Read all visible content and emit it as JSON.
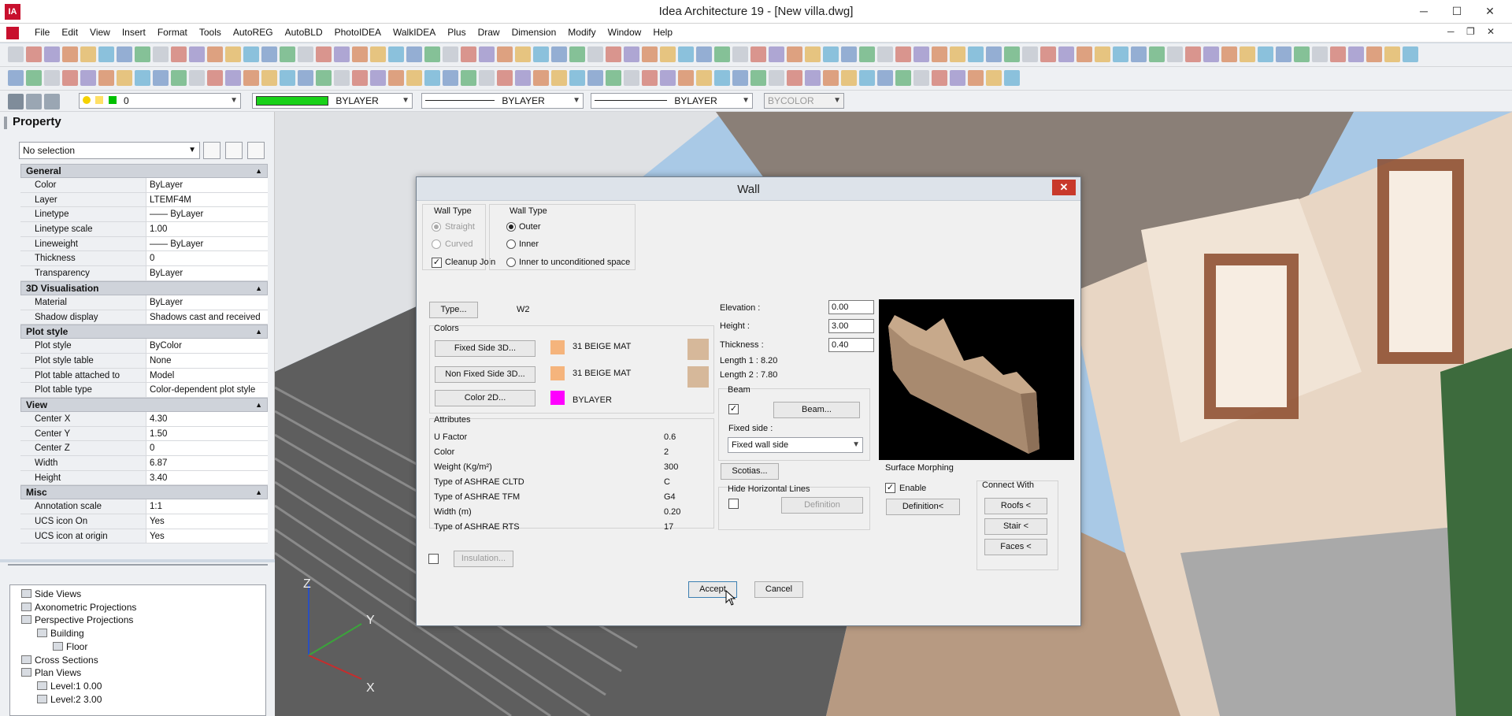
{
  "window": {
    "title": "Idea Architecture 19 - [New villa.dwg]",
    "app_icon": "IA",
    "minimize": "─",
    "maximize": "☐",
    "close": "✕",
    "doc_minimize": "─",
    "doc_restore": "❐",
    "doc_close": "✕"
  },
  "menu": [
    "File",
    "Edit",
    "View",
    "Insert",
    "Format",
    "Tools",
    "AutoREG",
    "AutoBLD",
    "PhotoIDEA",
    "WalkIDEA",
    "Plus",
    "Draw",
    "Dimension",
    "Modify",
    "Window",
    "Help"
  ],
  "layer_bar": {
    "layer": "0",
    "color": "BYLAYER",
    "linetype": "BYLAYER",
    "lineweight": "BYLAYER",
    "plotstyle": "BYCOLOR"
  },
  "property_panel": {
    "title": "Property",
    "selection": "No selection",
    "categories": [
      {
        "name": "General",
        "rows": [
          {
            "k": "Color",
            "v": "ByLayer"
          },
          {
            "k": "Layer",
            "v": "LTEMF4M"
          },
          {
            "k": "Linetype",
            "v": "—— ByLayer"
          },
          {
            "k": "Linetype scale",
            "v": "1.00"
          },
          {
            "k": "Lineweight",
            "v": "—— ByLayer"
          },
          {
            "k": "Thickness",
            "v": "0"
          },
          {
            "k": "Transparency",
            "v": "ByLayer"
          }
        ]
      },
      {
        "name": "3D Visualisation",
        "rows": [
          {
            "k": "Material",
            "v": "ByLayer"
          },
          {
            "k": "Shadow display",
            "v": "Shadows cast and received"
          }
        ]
      },
      {
        "name": "Plot style",
        "rows": [
          {
            "k": "Plot style",
            "v": "ByColor"
          },
          {
            "k": "Plot style table",
            "v": "None"
          },
          {
            "k": "Plot table attached to",
            "v": "Model"
          },
          {
            "k": "Plot table type",
            "v": "Color-dependent plot style"
          }
        ]
      },
      {
        "name": "View",
        "rows": [
          {
            "k": "Center X",
            "v": "4.30"
          },
          {
            "k": "Center Y",
            "v": "1.50"
          },
          {
            "k": "Center Z",
            "v": "0"
          },
          {
            "k": "Width",
            "v": "6.87"
          },
          {
            "k": "Height",
            "v": "3.40"
          }
        ]
      },
      {
        "name": "Misc",
        "rows": [
          {
            "k": "Annotation scale",
            "v": "1:1"
          },
          {
            "k": "UCS icon On",
            "v": "Yes"
          },
          {
            "k": "UCS icon at origin",
            "v": "Yes"
          }
        ]
      }
    ]
  },
  "tree": [
    {
      "label": "Side Views",
      "level": 0
    },
    {
      "label": "Axonometric Projections",
      "level": 0
    },
    {
      "label": "Perspective Projections",
      "level": 0
    },
    {
      "label": "Building",
      "level": 1
    },
    {
      "label": "Floor",
      "level": 2
    },
    {
      "label": "Cross Sections",
      "level": 0
    },
    {
      "label": "Plan Views",
      "level": 0
    },
    {
      "label": "Level:1  0.00",
      "level": 1
    },
    {
      "label": "Level:2  3.00",
      "level": 1
    }
  ],
  "ucs": {
    "x": "X",
    "y": "Y",
    "z": "Z"
  },
  "dialog": {
    "title": "Wall",
    "close": "✕",
    "wall_type_shape": {
      "title": "Wall Type",
      "straight": "Straight",
      "curved": "Curved",
      "cleanup": "Cleanup Join"
    },
    "wall_type_pos": {
      "title": "Wall Type",
      "outer": "Outer",
      "inner": "Inner",
      "inner_uncond": "Inner to unconditioned space"
    },
    "type_button": "Type...",
    "type_value": "W2",
    "colors": {
      "title": "Colors",
      "fixed_side_button": "Fixed Side 3D...",
      "fixed_side_value": "31 BEIGE MAT",
      "fixed_side_color": "#f5b47c",
      "non_fixed_button": "Non Fixed Side 3D...",
      "non_fixed_value": "31 BEIGE MAT",
      "non_fixed_color": "#f5b47c",
      "color2d_button": "Color 2D...",
      "color2d_value": "BYLAYER",
      "color2d_color": "#ff00ff",
      "material_color": "#d6b89a"
    },
    "attributes": {
      "title": "Attributes",
      "rows": [
        {
          "k": "U Factor",
          "v": "0.6"
        },
        {
          "k": "Color",
          "v": "2"
        },
        {
          "k": "Weight (Kg/m²)",
          "v": "300"
        },
        {
          "k": "Type of ASHRAE CLTD",
          "v": "C"
        },
        {
          "k": "Type of ASHRAE TFM",
          "v": "G4"
        },
        {
          "k": "Width (m)",
          "v": "0.20"
        },
        {
          "k": "Type of ASHRAE RTS",
          "v": "17"
        }
      ]
    },
    "insulation_button": "Insulation...",
    "elevation_label": "Elevation :",
    "elevation_value": "0.00",
    "height_label": "Height :",
    "height_value": "3.00",
    "thickness_label": "Thickness :",
    "thickness_value": "0.40",
    "length1": "Length 1 :   8.20",
    "length2": "Length 2 :   7.80",
    "beam": {
      "title": "Beam",
      "button": "Beam..."
    },
    "fixed_side_label": "Fixed side :",
    "fixed_side_option": "Fixed wall side",
    "scotias_button": "Scotias...",
    "hide_lines": {
      "title": "Hide Horizontal Lines",
      "button": "Definition"
    },
    "surface_morphing": {
      "title": "Surface Morphing",
      "enable": "Enable",
      "button": "Definition<"
    },
    "connect_with": {
      "title": "Connect With",
      "roofs": "Roofs <",
      "stair": "Stair <",
      "faces": "Faces <"
    },
    "accept": "Accept",
    "cancel": "Cancel"
  }
}
